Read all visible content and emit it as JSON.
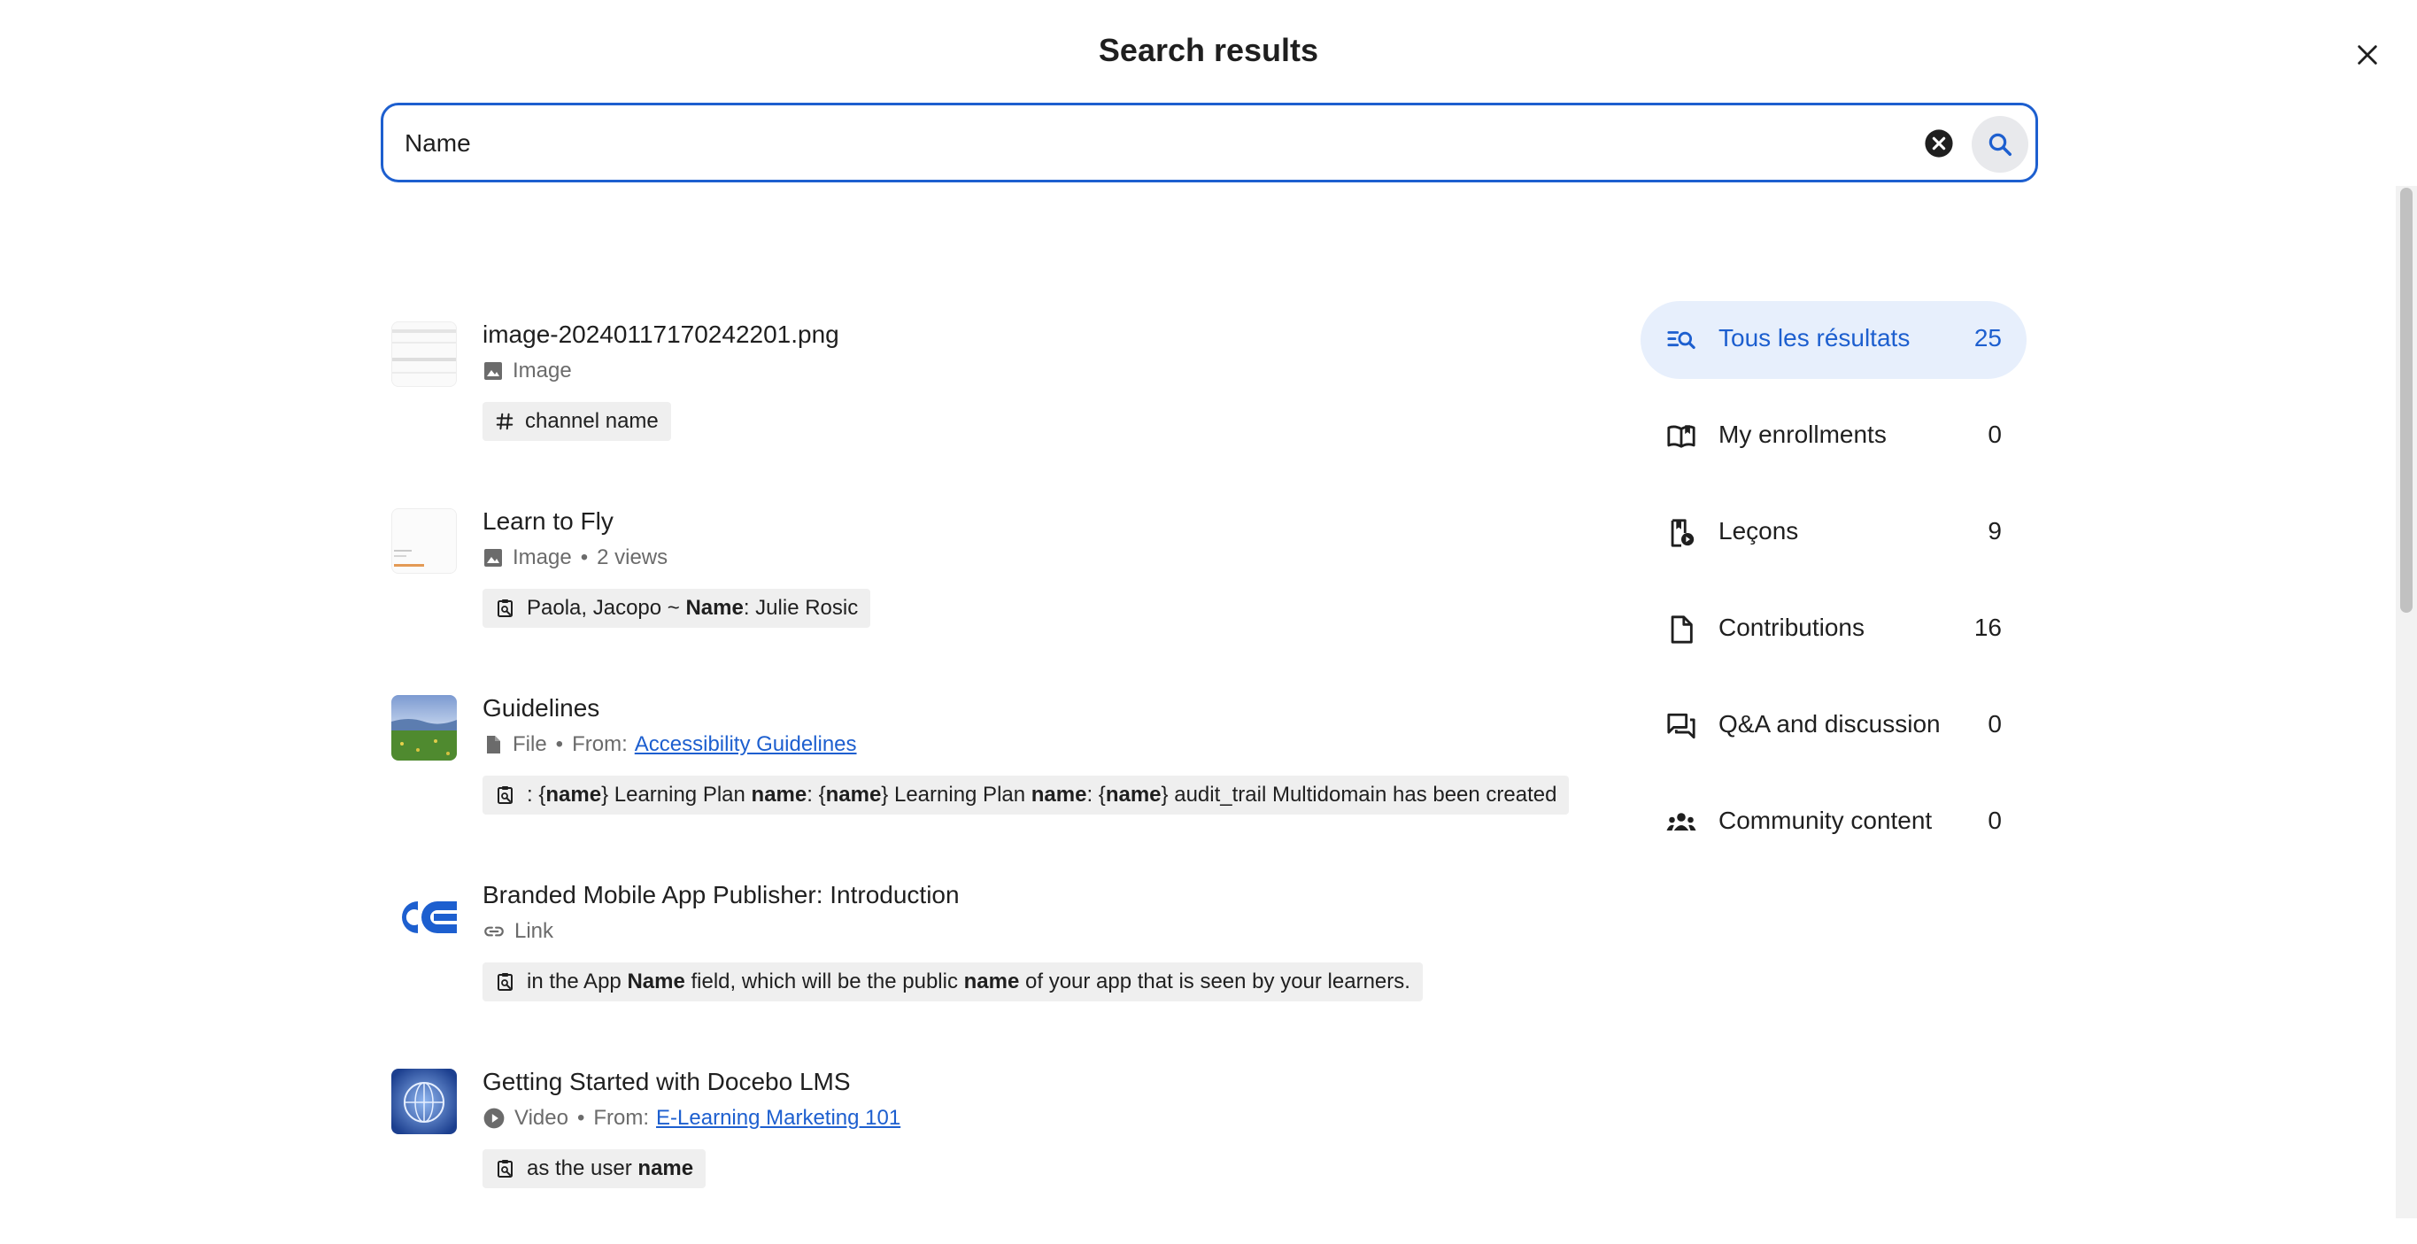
{
  "page": {
    "title": "Search results"
  },
  "search": {
    "value": "Name",
    "placeholder": ""
  },
  "results": [
    {
      "title": "image-20240117170242201.png",
      "type": "Image",
      "type_icon": "image-icon",
      "views": "",
      "from_label": "",
      "from_link": "",
      "snippet_icon": "hashtag-icon",
      "snippet_parts": [
        {
          "text": "channel name",
          "bold": false
        }
      ]
    },
    {
      "title": "Learn to Fly",
      "type": "Image",
      "type_icon": "image-icon",
      "views": "2 views",
      "from_label": "",
      "from_link": "",
      "snippet_icon": "content-search-icon",
      "snippet_parts": [
        {
          "text": "Paola, Jacopo ~ ",
          "bold": false
        },
        {
          "text": "Name",
          "bold": true
        },
        {
          "text": ": Julie Rosic",
          "bold": false
        }
      ]
    },
    {
      "title": "Guidelines",
      "type": "File",
      "type_icon": "file-icon",
      "views": "",
      "from_label": "From:",
      "from_link": "Accessibility Guidelines",
      "snippet_icon": "content-search-icon",
      "snippet_parts": [
        {
          "text": ": {",
          "bold": false
        },
        {
          "text": "name",
          "bold": true
        },
        {
          "text": "} Learning Plan ",
          "bold": false
        },
        {
          "text": "name",
          "bold": true
        },
        {
          "text": ": {",
          "bold": false
        },
        {
          "text": "name",
          "bold": true
        },
        {
          "text": "} Learning Plan ",
          "bold": false
        },
        {
          "text": "name",
          "bold": true
        },
        {
          "text": ": {",
          "bold": false
        },
        {
          "text": "name",
          "bold": true
        },
        {
          "text": "} audit_trail Multidomain has been created",
          "bold": false
        }
      ]
    },
    {
      "title": "Branded Mobile App Publisher: Introduction",
      "type": "Link",
      "type_icon": "link-icon",
      "views": "",
      "from_label": "",
      "from_link": "",
      "snippet_icon": "content-search-icon",
      "snippet_parts": [
        {
          "text": "in the App ",
          "bold": false
        },
        {
          "text": "Name",
          "bold": true
        },
        {
          "text": " field, which will be the public ",
          "bold": false
        },
        {
          "text": "name",
          "bold": true
        },
        {
          "text": " of your app that is seen by your learners.",
          "bold": false
        }
      ]
    },
    {
      "title": "Getting Started with Docebo LMS",
      "type": "Video",
      "type_icon": "play-circle-icon",
      "views": "",
      "from_label": "From:",
      "from_link": "E-Learning Marketing 101",
      "snippet_icon": "content-search-icon",
      "snippet_parts": [
        {
          "text": "as the user ",
          "bold": false
        },
        {
          "text": "name",
          "bold": true
        }
      ]
    }
  ],
  "filters": [
    {
      "label": "Tous les résultats",
      "count": "25",
      "icon": "search-list-icon",
      "active": true
    },
    {
      "label": "My enrollments",
      "count": "0",
      "icon": "open-book-icon",
      "active": false
    },
    {
      "label": "Leçons",
      "count": "9",
      "icon": "lesson-icon",
      "active": false
    },
    {
      "label": "Contributions",
      "count": "16",
      "icon": "document-icon",
      "active": false
    },
    {
      "label": "Q&A and discussion",
      "count": "0",
      "icon": "chat-icon",
      "active": false
    },
    {
      "label": "Community content",
      "count": "0",
      "icon": "community-icon",
      "active": false
    }
  ],
  "colors": {
    "accent": "#1d5fcf",
    "active_bg": "#e7effc",
    "snippet_bg": "#efefef",
    "meta_text": "#6b6b6b"
  }
}
